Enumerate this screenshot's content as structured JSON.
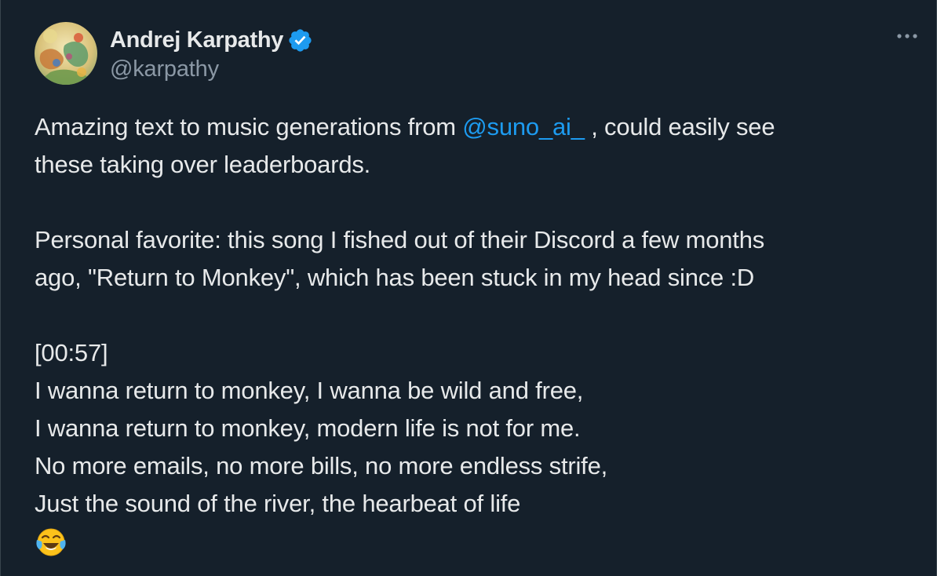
{
  "author": {
    "display_name": "Andrej Karpathy",
    "handle": "@karpathy",
    "verified_color": "#1d9bf0"
  },
  "tweet": {
    "line1_before": "Amazing text to music generations from ",
    "mention": "@suno_ai_",
    "line1_after": " , could easily see",
    "line2": "these taking over leaderboards.",
    "line3": "Personal favorite: this song I fished out of their Discord a few months",
    "line4": "ago, \"Return to Monkey\", which has been stuck in my head since :D",
    "line5": "[00:57]",
    "line6": "I wanna return to monkey, I wanna be wild and free,",
    "line7": "I wanna return to monkey, modern life is not for me.",
    "line8": "No more emails, no more bills, no more endless strife,",
    "line9": "Just the sound of the river, the hearbeat of life",
    "emoji": "face-with-tears-of-joy"
  },
  "colors": {
    "background": "#15202b",
    "text": "#e7e9ea",
    "secondary_text": "#8b98a5",
    "link": "#1d9bf0"
  }
}
